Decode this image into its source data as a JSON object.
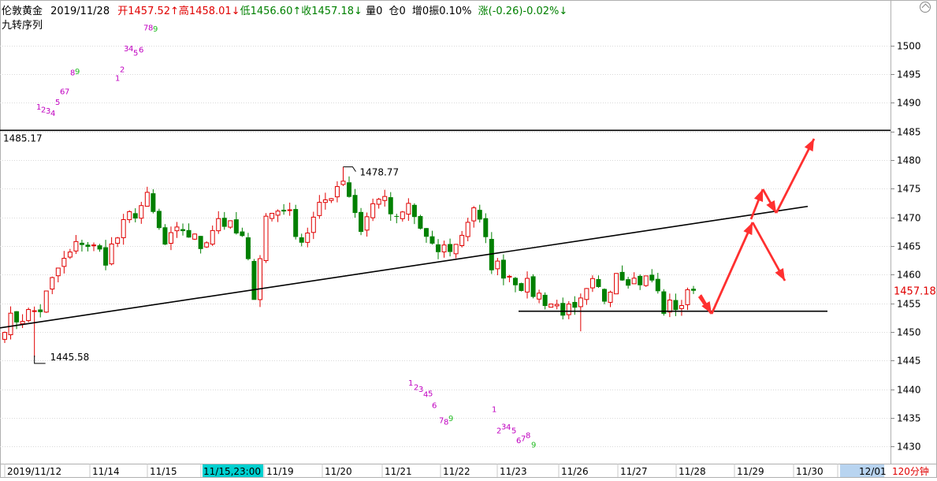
{
  "header": {
    "symbol": "伦敦黄金",
    "date": "2019/11/28",
    "open_label": "开",
    "open": "1457.52↑",
    "high_label": "高",
    "high": "1458.01↓",
    "low_label": "低",
    "low": "1456.60↑",
    "close_label": "收",
    "close": "1457.18↓",
    "volume": "量0",
    "position": "仓0",
    "increase": "增0",
    "amplitude": "振0.10%",
    "change": "涨(-0.26)-0.02%↓",
    "indicator": "九转序列"
  },
  "colors": {
    "up": "#e00000",
    "down": "#008000",
    "purple": "#c000c0",
    "green_digit": "#22bb22",
    "arrow": "#ff3030",
    "price_tag": "#e00000",
    "time_highlight": "#00d0d0",
    "right_highlight": "#b8d4f0"
  },
  "chart_data": {
    "type": "candlestick",
    "ylim": [
      1427,
      1506
    ],
    "y_ticks": [
      1430,
      1435,
      1440,
      1445,
      1450,
      1455,
      1460,
      1465,
      1470,
      1475,
      1480,
      1485,
      1490,
      1495,
      1500
    ],
    "x_labels": [
      "2019/11/12",
      "11/14",
      "11/15",
      "11/15,23:00",
      "11/19",
      "11/20",
      "11/21",
      "11/22",
      "11/23",
      "11/26",
      "11/27",
      "11/28",
      "11/29",
      "11/30",
      "12/01"
    ],
    "highlighted_x_label": "11/15,23:00",
    "period_label": "120分钟",
    "current_price": "1457.18",
    "horizontal_line": "1485.17",
    "high_marker": "1478.77",
    "low_marker": "1445.58",
    "anchors": [
      {
        "i": 0,
        "c": 1451.5
      },
      {
        "i": 6,
        "c": 1454
      },
      {
        "i": 9,
        "c": 1461
      },
      {
        "i": 13,
        "c": 1466
      },
      {
        "i": 17,
        "c": 1463
      },
      {
        "i": 21,
        "c": 1470
      },
      {
        "i": 24,
        "c": 1473
      },
      {
        "i": 27,
        "c": 1465
      },
      {
        "i": 30,
        "c": 1468
      },
      {
        "i": 33,
        "c": 1465
      },
      {
        "i": 36,
        "c": 1470
      },
      {
        "i": 40,
        "c": 1466
      },
      {
        "i": 42,
        "c": 1457
      },
      {
        "i": 44,
        "c": 1470
      },
      {
        "i": 47,
        "c": 1472
      },
      {
        "i": 50,
        "c": 1466
      },
      {
        "i": 54,
        "c": 1473
      },
      {
        "i": 57,
        "c": 1477
      },
      {
        "i": 60,
        "c": 1468
      },
      {
        "i": 63,
        "c": 1474
      },
      {
        "i": 66,
        "c": 1469
      },
      {
        "i": 68,
        "c": 1472
      },
      {
        "i": 72,
        "c": 1464
      },
      {
        "i": 76,
        "c": 1465
      },
      {
        "i": 79,
        "c": 1472
      },
      {
        "i": 82,
        "c": 1462
      },
      {
        "i": 85,
        "c": 1460
      },
      {
        "i": 89,
        "c": 1457
      },
      {
        "i": 92,
        "c": 1455
      },
      {
        "i": 96,
        "c": 1453
      },
      {
        "i": 99,
        "c": 1458
      },
      {
        "i": 101,
        "c": 1456
      },
      {
        "i": 103,
        "c": 1461
      },
      {
        "i": 106,
        "c": 1459
      },
      {
        "i": 109,
        "c": 1459
      },
      {
        "i": 111,
        "c": 1454
      },
      {
        "i": 114,
        "c": 1455
      },
      {
        "i": 116,
        "c": 1457.18
      }
    ],
    "sequence_digits": [
      {
        "t": "1",
        "x": 46,
        "p": 1488.8,
        "color": "purple"
      },
      {
        "t": "2",
        "x": 52,
        "p": 1488.3,
        "color": "purple"
      },
      {
        "t": "3",
        "x": 58,
        "p": 1488.1,
        "color": "purple"
      },
      {
        "t": "4",
        "x": 64,
        "p": 1487.7,
        "color": "purple"
      },
      {
        "t": "5",
        "x": 70,
        "p": 1489.6,
        "color": "purple"
      },
      {
        "t": "6",
        "x": 76,
        "p": 1491.5,
        "color": "purple"
      },
      {
        "t": "7",
        "x": 82,
        "p": 1491.5,
        "color": "purple"
      },
      {
        "t": "8",
        "x": 89,
        "p": 1494.8,
        "color": "purple"
      },
      {
        "t": "9",
        "x": 95,
        "p": 1495.0,
        "color": "green_digit"
      },
      {
        "t": "1",
        "x": 146,
        "p": 1493.8,
        "color": "purple"
      },
      {
        "t": "2",
        "x": 152,
        "p": 1495.3,
        "color": "purple"
      },
      {
        "t": "3",
        "x": 157,
        "p": 1499.0,
        "color": "purple"
      },
      {
        "t": "4",
        "x": 163,
        "p": 1499.0,
        "color": "purple"
      },
      {
        "t": "5",
        "x": 169,
        "p": 1498.2,
        "color": "purple"
      },
      {
        "t": "6",
        "x": 176,
        "p": 1498.8,
        "color": "purple"
      },
      {
        "t": "7",
        "x": 182,
        "p": 1502.6,
        "color": "purple"
      },
      {
        "t": "8",
        "x": 188,
        "p": 1502.6,
        "color": "purple"
      },
      {
        "t": "9",
        "x": 194,
        "p": 1502.4,
        "color": "green_digit"
      },
      {
        "t": "1",
        "x": 518,
        "p": 1440.6,
        "color": "purple"
      },
      {
        "t": "2",
        "x": 525,
        "p": 1439.9,
        "color": "purple"
      },
      {
        "t": "3",
        "x": 531,
        "p": 1439.5,
        "color": "purple"
      },
      {
        "t": "4",
        "x": 537,
        "p": 1438.6,
        "color": "purple"
      },
      {
        "t": "5",
        "x": 543,
        "p": 1438.8,
        "color": "purple"
      },
      {
        "t": "6",
        "x": 548,
        "p": 1436.7,
        "color": "purple"
      },
      {
        "t": "7",
        "x": 557,
        "p": 1434.1,
        "color": "purple"
      },
      {
        "t": "8",
        "x": 563,
        "p": 1433.8,
        "color": "purple"
      },
      {
        "t": "9",
        "x": 569,
        "p": 1434.4,
        "color": "green_digit"
      },
      {
        "t": "1",
        "x": 624,
        "p": 1436.0,
        "color": "purple"
      },
      {
        "t": "2",
        "x": 630,
        "p": 1432.3,
        "color": "purple"
      },
      {
        "t": "3",
        "x": 636,
        "p": 1433.0,
        "color": "purple"
      },
      {
        "t": "4",
        "x": 642,
        "p": 1432.9,
        "color": "purple"
      },
      {
        "t": "5",
        "x": 649,
        "p": 1432.3,
        "color": "purple"
      },
      {
        "t": "6",
        "x": 655,
        "p": 1430.6,
        "color": "purple"
      },
      {
        "t": "7",
        "x": 661,
        "p": 1430.9,
        "color": "purple"
      },
      {
        "t": "8",
        "x": 667,
        "p": 1431.5,
        "color": "purple"
      },
      {
        "t": "9",
        "x": 674,
        "p": 1429.8,
        "color": "green_digit"
      }
    ]
  }
}
